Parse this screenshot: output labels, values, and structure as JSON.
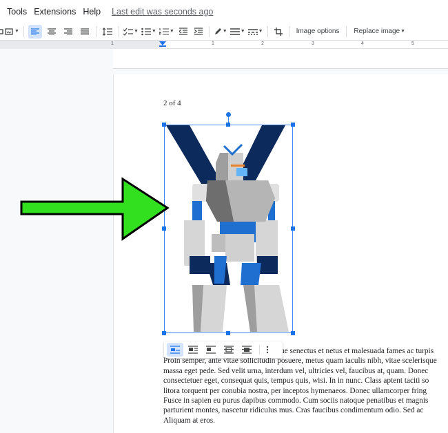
{
  "menu": {
    "items": [
      "Tools",
      "Extensions",
      "Help"
    ],
    "last_edit": "Last edit was seconds ago"
  },
  "toolbar": {
    "image_options": "Image options",
    "replace_image": "Replace image"
  },
  "ruler": {
    "numbers": [
      "1",
      "1",
      "2",
      "3",
      "4",
      "5"
    ]
  },
  "document": {
    "page_label": "2 of 4",
    "lines": [
      "ue senectus et netus et malesuada fames ac turpis",
      "Proin semper, ante vitae sollicitudin posuere, metus quam iaculis nibh, vitae scelerisque",
      "massa eget pede. Sed velit urna, interdum vel, ultricies vel, faucibus at, quam. Donec",
      "consectetuer eget, consequat quis, tempus quis, wisi. In in nunc. Class aptent taciti so",
      "litora torquent per conubia nostra, per inceptos hymenaeos. Donec ullamcorper fring",
      "Fusce in sapien eu purus dapibus commodo. Cum sociis natoque penatibus et magnis",
      "parturient montes, nascetur ridiculus mus. Cras faucibus condimentum odio. Sed ac",
      "Aliquam at eros."
    ]
  },
  "colors": {
    "accent": "#1a73e8",
    "arrow_green": "#33e01f",
    "robot_navy": "#0d2a5c",
    "robot_blue": "#1f6fd1"
  }
}
